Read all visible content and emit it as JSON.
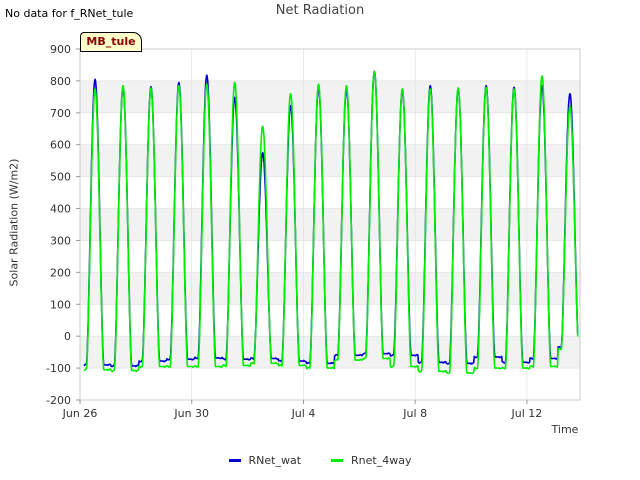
{
  "header": {
    "nodata_text": "No data for f_RNet_tule",
    "site_label": "MB_tule"
  },
  "colors": {
    "rnet_wat": "#0000cc",
    "rnet_4way": "#00ee00",
    "band": "#f2f2f2",
    "grid": "#dddddd"
  },
  "chart_data": {
    "type": "line",
    "title": "Net Radiation",
    "xlabel": "Time",
    "ylabel": "Solar Radiation (W/m2)",
    "ylim": [
      -200,
      900
    ],
    "yticks": [
      -200,
      -100,
      0,
      100,
      200,
      300,
      400,
      500,
      600,
      700,
      800,
      900
    ],
    "xlim": [
      "Jun 26",
      "Jul 14"
    ],
    "xticks": [
      "Jun 26",
      "Jun 30",
      "Jul 4",
      "Jul 8",
      "Jul 12"
    ],
    "grid": true,
    "legend_position": "bottom",
    "series": [
      {
        "name": "RNet_wat",
        "color": "#0000cc",
        "daily_peaks": [
          {
            "date": "Jun 26",
            "peak": 805,
            "night": -90
          },
          {
            "date": "Jun 27",
            "peak": 780,
            "night": -93
          },
          {
            "date": "Jun 28",
            "peak": 782,
            "night": -78
          },
          {
            "date": "Jun 29",
            "peak": 795,
            "night": -72
          },
          {
            "date": "Jun 30",
            "peak": 818,
            "night": -68
          },
          {
            "date": "Jul 1",
            "peak": 748,
            "night": -72
          },
          {
            "date": "Jul 2",
            "peak": 575,
            "night": -70
          },
          {
            "date": "Jul 3",
            "peak": 722,
            "night": -78
          },
          {
            "date": "Jul 4",
            "peak": 780,
            "night": -85
          },
          {
            "date": "Jul 5",
            "peak": 775,
            "night": -60
          },
          {
            "date": "Jul 6",
            "peak": 830,
            "night": -55
          },
          {
            "date": "Jul 7",
            "peak": 770,
            "night": -60
          },
          {
            "date": "Jul 8",
            "peak": 785,
            "night": -82
          },
          {
            "date": "Jul 9",
            "peak": 775,
            "night": -85
          },
          {
            "date": "Jul 10",
            "peak": 785,
            "night": -65
          },
          {
            "date": "Jul 11",
            "peak": 780,
            "night": -82
          },
          {
            "date": "Jul 12",
            "peak": 785,
            "night": -70
          },
          {
            "date": "Jul 13",
            "peak": 760,
            "night": -35
          }
        ]
      },
      {
        "name": "Rnet_4way",
        "color": "#00ee00",
        "daily_peaks": [
          {
            "date": "Jun 26",
            "peak": 775,
            "night": -105
          },
          {
            "date": "Jun 27",
            "peak": 785,
            "night": -108
          },
          {
            "date": "Jun 28",
            "peak": 778,
            "night": -95
          },
          {
            "date": "Jun 29",
            "peak": 785,
            "night": -95
          },
          {
            "date": "Jun 30",
            "peak": 790,
            "night": -95
          },
          {
            "date": "Jul 1",
            "peak": 795,
            "night": -92
          },
          {
            "date": "Jul 2",
            "peak": 658,
            "night": -85
          },
          {
            "date": "Jul 3",
            "peak": 760,
            "night": -92
          },
          {
            "date": "Jul 4",
            "peak": 790,
            "night": -100
          },
          {
            "date": "Jul 5",
            "peak": 785,
            "night": -75
          },
          {
            "date": "Jul 6",
            "peak": 830,
            "night": -70
          },
          {
            "date": "Jul 7",
            "peak": 775,
            "night": -95
          },
          {
            "date": "Jul 8",
            "peak": 775,
            "night": -110
          },
          {
            "date": "Jul 9",
            "peak": 778,
            "night": -115
          },
          {
            "date": "Jul 10",
            "peak": 780,
            "night": -100
          },
          {
            "date": "Jul 11",
            "peak": 775,
            "night": -100
          },
          {
            "date": "Jul 12",
            "peak": 815,
            "night": -95
          },
          {
            "date": "Jul 13",
            "peak": 720,
            "night": -40
          }
        ]
      }
    ]
  }
}
